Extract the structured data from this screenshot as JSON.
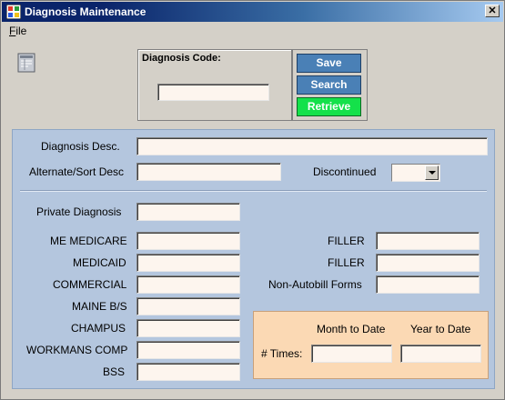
{
  "window": {
    "title": "Diagnosis Maintenance",
    "close_glyph": "✕"
  },
  "menu": {
    "file": "File"
  },
  "code_panel": {
    "label": "Diagnosis Code:",
    "value": ""
  },
  "buttons": {
    "save": "Save",
    "search": "Search",
    "retrieve": "Retrieve"
  },
  "fields": {
    "diagnosis_desc": {
      "label": "Diagnosis Desc.",
      "value": ""
    },
    "alternate_sort_desc": {
      "label": "Alternate/Sort Desc",
      "value": ""
    },
    "discontinued": {
      "label": "Discontinued",
      "selected": ""
    },
    "private_diagnosis": {
      "label": "Private Diagnosis",
      "value": ""
    },
    "me_medicare": {
      "label": "ME MEDICARE",
      "value": ""
    },
    "medicaid": {
      "label": "MEDICAID",
      "value": ""
    },
    "commercial": {
      "label": "COMMERCIAL",
      "value": ""
    },
    "maine_bs": {
      "label": "MAINE B/S",
      "value": ""
    },
    "champus": {
      "label": "CHAMPUS",
      "value": ""
    },
    "workmans_comp": {
      "label": "WORKMANS COMP",
      "value": ""
    },
    "bss": {
      "label": "BSS",
      "value": ""
    },
    "filler1": {
      "label": "FILLER",
      "value": ""
    },
    "filler2": {
      "label": "FILLER",
      "value": ""
    },
    "non_autobill_forms": {
      "label": "Non-Autobill Forms",
      "value": ""
    }
  },
  "times": {
    "month_to_date_header": "Month to Date",
    "year_to_date_header": "Year to Date",
    "row_label": "# Times:",
    "month_to_date_value": "",
    "year_to_date_value": ""
  },
  "icons": {
    "app": "app-window-icon",
    "report": "report-icon",
    "close": "close-icon",
    "dropdown": "chevron-down-icon"
  },
  "colors": {
    "titlebar": "#0a246a",
    "panel_bg": "#b4c6de",
    "field_bg": "#fdf5ee",
    "button_blue": "#4a80b6",
    "button_green": "#14e14a",
    "times_bg": "#fbd9b4"
  }
}
